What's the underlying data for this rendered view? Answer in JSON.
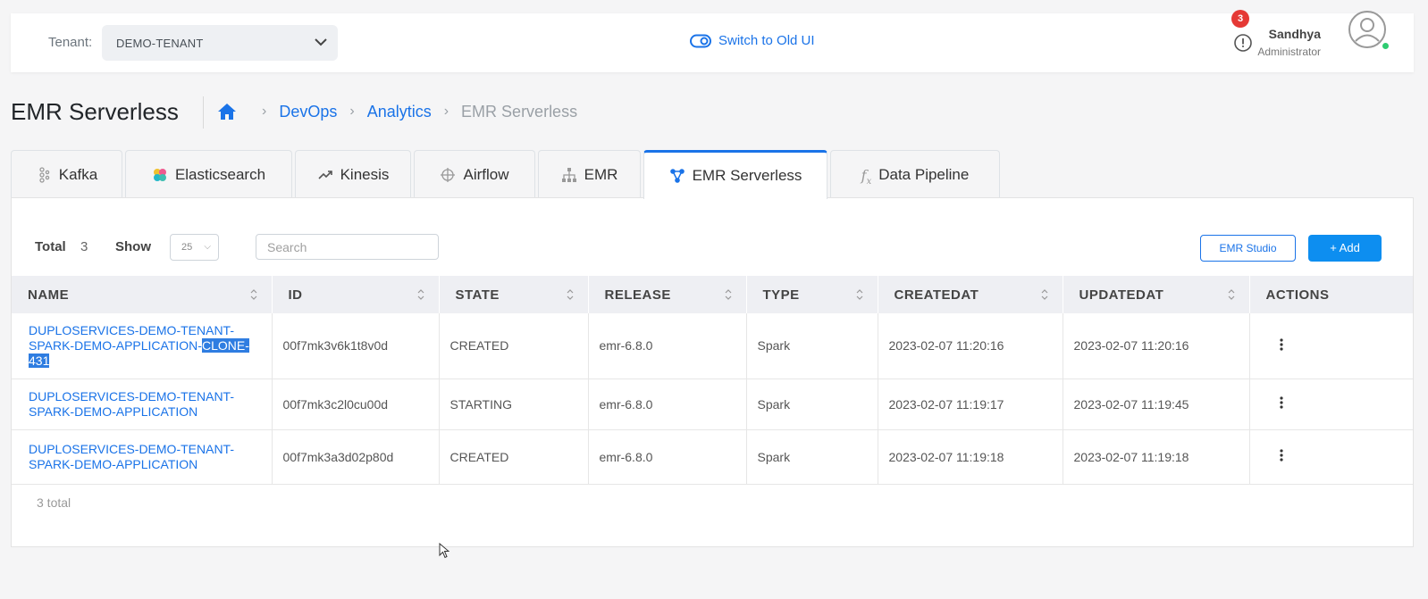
{
  "topbar": {
    "tenant_label": "Tenant:",
    "tenant_value": "DEMO-TENANT",
    "switch_label": "Switch to Old UI",
    "notification_count": "3",
    "user_name": "Sandhya",
    "user_role": "Administrator"
  },
  "header": {
    "title": "EMR Serverless",
    "breadcrumb": [
      "DevOps",
      "Analytics",
      "EMR Serverless"
    ]
  },
  "tabs": [
    {
      "label": "Kafka",
      "icon": "kafka-icon"
    },
    {
      "label": "Elasticsearch",
      "icon": "elasticsearch-icon"
    },
    {
      "label": "Kinesis",
      "icon": "trending-up-icon"
    },
    {
      "label": "Airflow",
      "icon": "airflow-icon"
    },
    {
      "label": "EMR",
      "icon": "sitemap-icon"
    },
    {
      "label": "EMR Serverless",
      "icon": "share-nodes-icon"
    },
    {
      "label": "Data Pipeline",
      "icon": "function-icon"
    }
  ],
  "active_tab": "EMR Serverless",
  "toolbar": {
    "total_label": "Total",
    "total_value": "3",
    "show_label": "Show",
    "show_value": "25",
    "search_placeholder": "Search",
    "studio_label": "EMR Studio",
    "add_label": "+ Add"
  },
  "table": {
    "columns": [
      "NAME",
      "ID",
      "STATE",
      "RELEASE",
      "TYPE",
      "CREATEDAT",
      "UPDATEDAT",
      "ACTIONS"
    ],
    "rows": [
      {
        "name_prefix": "DUPLOSERVICES-DEMO-TENANT-SPARK-DEMO-APPLICATION-",
        "name_highlight": "CLONE-431",
        "id": "00f7mk3v6k1t8v0d",
        "state": "CREATED",
        "release": "emr-6.8.0",
        "type": "Spark",
        "createdat": "2023-02-07 11:20:16",
        "updatedat": "2023-02-07 11:20:16"
      },
      {
        "name_prefix": "DUPLOSERVICES-DEMO-TENANT-SPARK-DEMO-APPLICATION",
        "name_highlight": "",
        "id": "00f7mk3c2l0cu00d",
        "state": "STARTING",
        "release": "emr-6.8.0",
        "type": "Spark",
        "createdat": "2023-02-07 11:19:17",
        "updatedat": "2023-02-07 11:19:45"
      },
      {
        "name_prefix": "DUPLOSERVICES-DEMO-TENANT-SPARK-DEMO-APPLICATION",
        "name_highlight": "",
        "id": "00f7mk3a3d02p80d",
        "state": "CREATED",
        "release": "emr-6.8.0",
        "type": "Spark",
        "createdat": "2023-02-07 11:19:18",
        "updatedat": "2023-02-07 11:19:18"
      }
    ],
    "footer_total": "3 total"
  },
  "colors": {
    "accent": "#1a73e8",
    "add_button": "#0d8ef0",
    "badge": "#e53935",
    "online": "#2ecc71"
  }
}
